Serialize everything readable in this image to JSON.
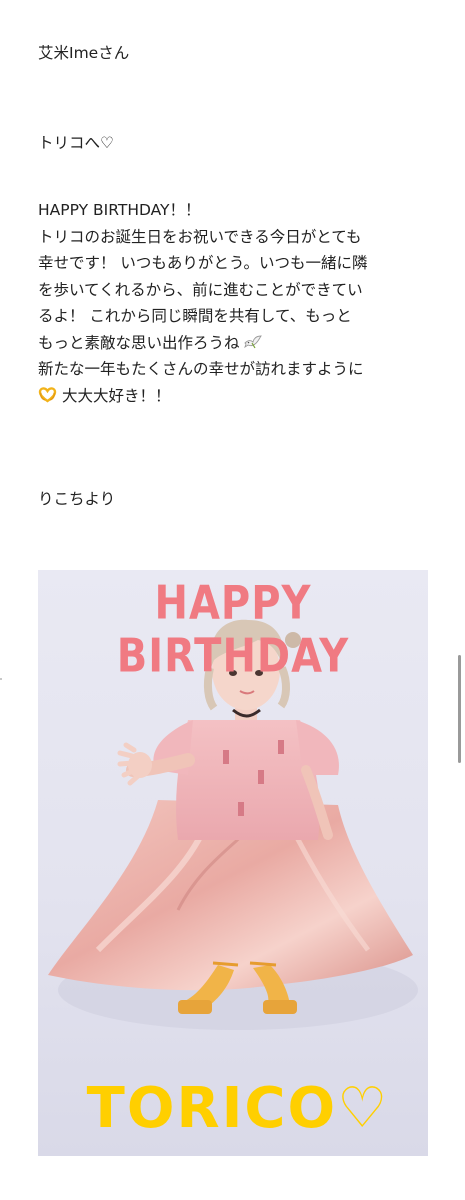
{
  "post": {
    "addressee": "艾米Imeさん",
    "greeting": "トリコへ♡",
    "message_lines": [
      "HAPPY BIRTHDAY！！",
      "トリコのお誕生日をお祝いできる今日がとても",
      "幸せです！ いつもありがとう。いつも一緒に隣",
      "を歩いてくれるから、前に進むことができてい",
      "るよ！ これから同じ瞬間を共有して、もっと",
      "もっと素敵な思い出作ろうね",
      "新たな一年もたくさんの幸せが訪れますように",
      "大大大好き！！"
    ],
    "line6_icon": "dove-emoji-icon",
    "line8_icon": "heart-hands-emoji-icon",
    "signature": "りこちより"
  },
  "photo": {
    "header_text": "HAPPY BIRTHDAY",
    "footer_text": "TORICO",
    "footer_heart": "♡",
    "header_color": "#f07a82",
    "footer_color": "#ffcf00"
  }
}
